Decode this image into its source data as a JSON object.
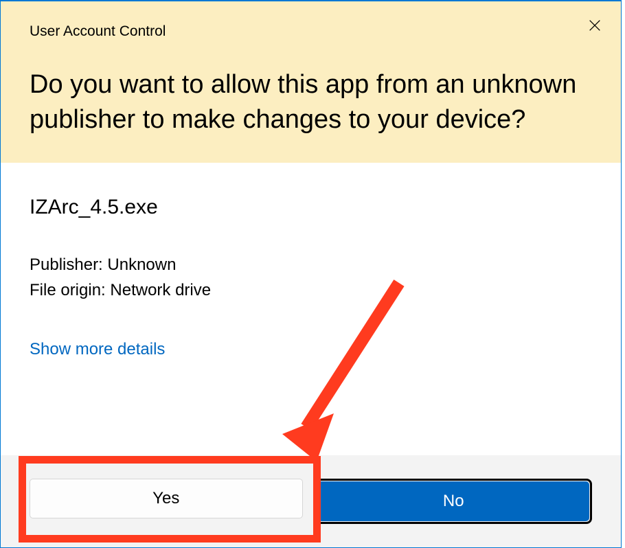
{
  "dialog": {
    "title_small": "User Account Control",
    "title_large": "Do you want to allow this app from an unknown publisher to make changes to your device?"
  },
  "details": {
    "app_name": "IZArc_4.5.exe",
    "publisher_label": "Publisher:",
    "publisher_value": "Unknown",
    "origin_label": "File origin:",
    "origin_value": "Network drive",
    "show_more": "Show more details"
  },
  "buttons": {
    "yes": "Yes",
    "no": "No"
  },
  "annotation": {
    "highlight_color": "#ff3b1f",
    "arrow_color": "#ff3b1f"
  }
}
